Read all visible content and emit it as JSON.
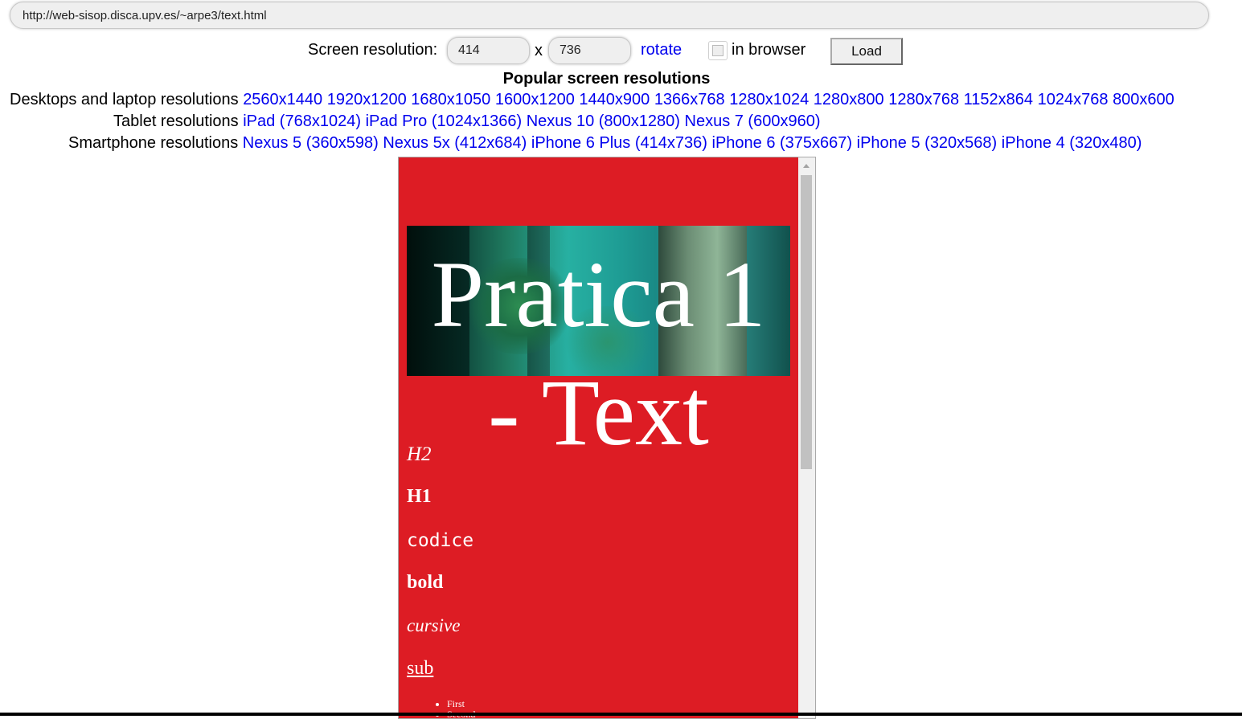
{
  "url": "http://web-sisop.disca.upv.es/~arpe3/text.html",
  "controls": {
    "screen_resolution_label": "Screen resolution:",
    "width_value": "414",
    "height_value": "736",
    "x_separator": "x",
    "rotate_label": "rotate",
    "in_browser_label": "in browser",
    "in_browser_checked": false,
    "load_label": "Load"
  },
  "popular": {
    "title": "Popular screen resolutions",
    "desktop_label": "Desktops and laptop resolutions",
    "desktop": [
      "2560x1440",
      "1920x1200",
      "1680x1050",
      "1600x1200",
      "1440x900",
      "1366x768",
      "1280x1024",
      "1280x800",
      "1280x768",
      "1152x864",
      "1024x768",
      "800x600"
    ],
    "tablet_label": "Tablet resolutions",
    "tablet": [
      "iPad (768x1024)",
      "iPad Pro (1024x1366)",
      "Nexus 10 (800x1280)",
      "Nexus 7 (600x960)"
    ],
    "smartphone_label": "Smartphone resolutions",
    "smartphone": [
      "Nexus 5 (360x598)",
      "Nexus 5x (412x684)",
      "iPhone 6 Plus (414x736)",
      "iPhone 6 (375x667)",
      "iPhone 5 (320x568)",
      "iPhone 4 (320x480)"
    ]
  },
  "preview": {
    "background_color": "#dd1c24",
    "hero_title_line1": "Pratica 1",
    "hero_title_line2": "- Text",
    "h2": "H2",
    "h1": "H1",
    "code": "codice",
    "bold": "bold",
    "cursive": "cursive",
    "sub": "sub",
    "list": [
      "First",
      "Second"
    ]
  },
  "colors": {
    "link": "#0000ee",
    "preview_bg": "#dd1c24"
  }
}
